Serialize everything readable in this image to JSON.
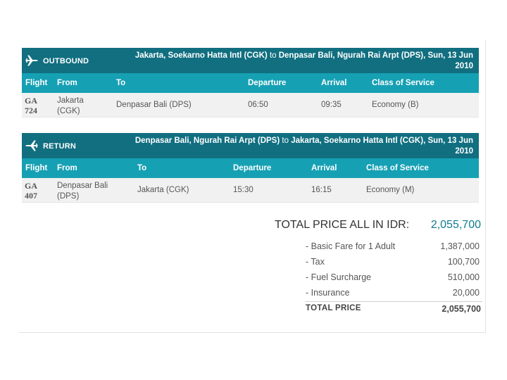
{
  "outbound": {
    "label": "OUTBOUND",
    "route_from": "Jakarta, Soekarno Hatta Intl (CGK)",
    "route_to_word": "to",
    "route_dest": "Denpasar Bali, Ngurah Rai Arpt (DPS), Sun, 13 Jun 2010",
    "columns": [
      "Flight",
      "From",
      "To",
      "Departure",
      "Arrival",
      "Class of Service"
    ],
    "row": {
      "flight_line1": "GA",
      "flight_line2": "724",
      "from_line1": "Jakarta",
      "from_line2": "(CGK)",
      "to": "Denpasar Bali (DPS)",
      "departure": "06:50",
      "arrival": "09:35",
      "class": "Economy (B)"
    }
  },
  "return": {
    "label": "RETURN",
    "route_from": "Denpasar Bali, Ngurah Rai Arpt (DPS)",
    "route_to_word": "to",
    "route_dest": "Jakarta, Soekarno Hatta Intl (CGK), Sun, 13 Jun 2010",
    "columns": [
      "Flight",
      "From",
      "To",
      "Departure",
      "Arrival",
      "Class of Service"
    ],
    "row": {
      "flight_line1": "GA",
      "flight_line2": "407",
      "from_line1": "Denpasar Bali",
      "from_line2": "(DPS)",
      "to": "Jakarta (CGK)",
      "departure": "15:30",
      "arrival": "16:15",
      "class": "Economy (M)"
    }
  },
  "totals": {
    "headline_label": "TOTAL PRICE ALL IN IDR:",
    "headline_value": "2,055,700",
    "breakdown": [
      {
        "label": "- Basic Fare for 1 Adult",
        "value": "1,387,000"
      },
      {
        "label": "- Tax",
        "value": "100,700"
      },
      {
        "label": "- Fuel Surcharge",
        "value": "510,000"
      },
      {
        "label": "- Insurance",
        "value": "20,000"
      }
    ],
    "total_label": "TOTAL PRICE",
    "total_value": "2,055,700",
    "accent_color": "#117b8c"
  },
  "colors": {
    "header": "#116f80",
    "column_bar": "#16a0b4",
    "row_bg": "#f1f1f1"
  },
  "icons": {
    "section": "airplane-icon"
  }
}
